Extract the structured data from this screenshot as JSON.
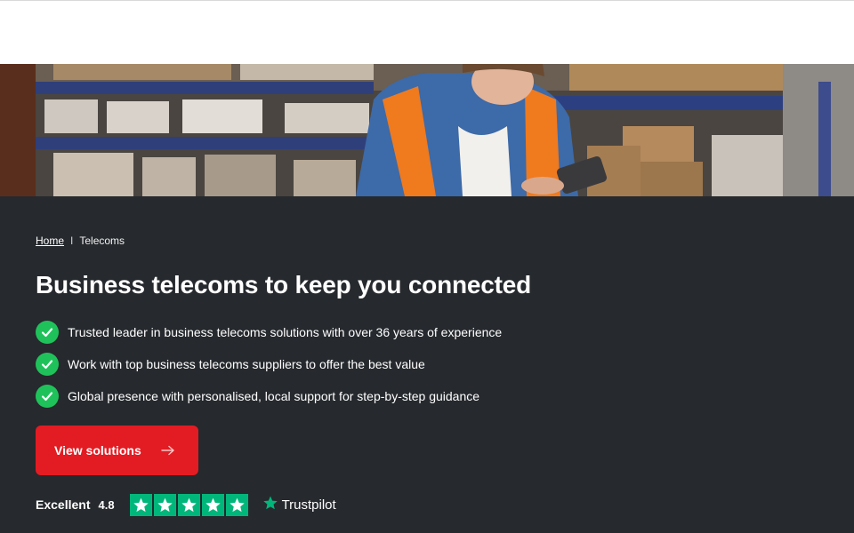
{
  "colors": {
    "background": "#26292d",
    "accent_red": "#e31c23",
    "check_green": "#1fc25a",
    "trustpilot_green": "#00b67a"
  },
  "breadcrumb": {
    "home": "Home",
    "separator": "I",
    "current": "Telecoms"
  },
  "hero_image": {
    "icon": "warehouse-worker-photo"
  },
  "page_title": "Business telecoms to keep you connected",
  "benefits": [
    {
      "icon": "check-icon",
      "text": "Trusted leader in business telecoms solutions with over 36 years of experience"
    },
    {
      "icon": "check-icon",
      "text": "Work with top business telecoms suppliers to offer the best value"
    },
    {
      "icon": "check-icon",
      "text": "Global presence with personalised, local support for step-by-step guidance"
    }
  ],
  "cta": {
    "label": "View solutions",
    "icon": "arrow-right-icon"
  },
  "rating": {
    "word": "Excellent",
    "score": "4.8",
    "stars": 5,
    "provider": "Trustpilot"
  }
}
